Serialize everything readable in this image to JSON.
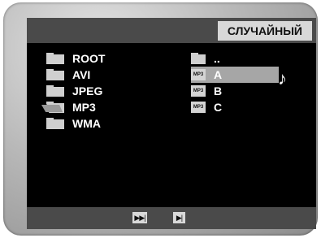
{
  "header": {
    "mode_label": "СЛУЧАЙНЫЙ"
  },
  "folders": [
    {
      "label": "ROOT",
      "icon": "folder-icon",
      "open": false
    },
    {
      "label": "AVI",
      "icon": "folder-icon",
      "open": false
    },
    {
      "label": "JPEG",
      "icon": "folder-icon",
      "open": false
    },
    {
      "label": "MP3",
      "icon": "open-folder-icon",
      "open": true
    },
    {
      "label": "WMA",
      "icon": "folder-icon",
      "open": false
    }
  ],
  "files": [
    {
      "label": "..",
      "icon": "folder-icon",
      "badge": "",
      "selected": false
    },
    {
      "label": "A",
      "icon": "mp3-file-icon",
      "badge": "MP3",
      "selected": true
    },
    {
      "label": "B",
      "icon": "mp3-file-icon",
      "badge": "MP3",
      "selected": false
    },
    {
      "label": "C",
      "icon": "mp3-file-icon",
      "badge": "MP3",
      "selected": false
    }
  ],
  "now_playing": {
    "icon": "music-note-icon",
    "glyph": "♪"
  },
  "controls": [
    {
      "name": "skip-forward",
      "glyph": "▶▶|"
    },
    {
      "name": "play-pause",
      "glyph": "▶|"
    }
  ],
  "colors": {
    "screen": "#000000",
    "bar": "#4a4a4a",
    "highlight": "#a6a6a6",
    "text": "#ffffff"
  }
}
